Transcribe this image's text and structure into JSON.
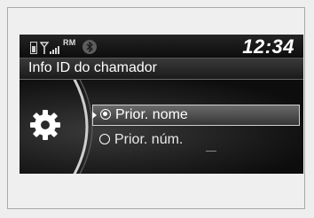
{
  "status_bar": {
    "signal_label": "RM",
    "clock": "12:34",
    "icons": [
      "battery-icon",
      "signal-icon",
      "bluetooth-icon"
    ]
  },
  "screen": {
    "title": "Info ID do chamador"
  },
  "options": [
    {
      "label": "Prior. nome",
      "selected": true
    },
    {
      "label": "Prior. núm.",
      "selected": false
    }
  ],
  "colors": {
    "screen_bg": "#0c0c0c",
    "text": "#ffffff",
    "highlight": "#5a5a5a"
  }
}
